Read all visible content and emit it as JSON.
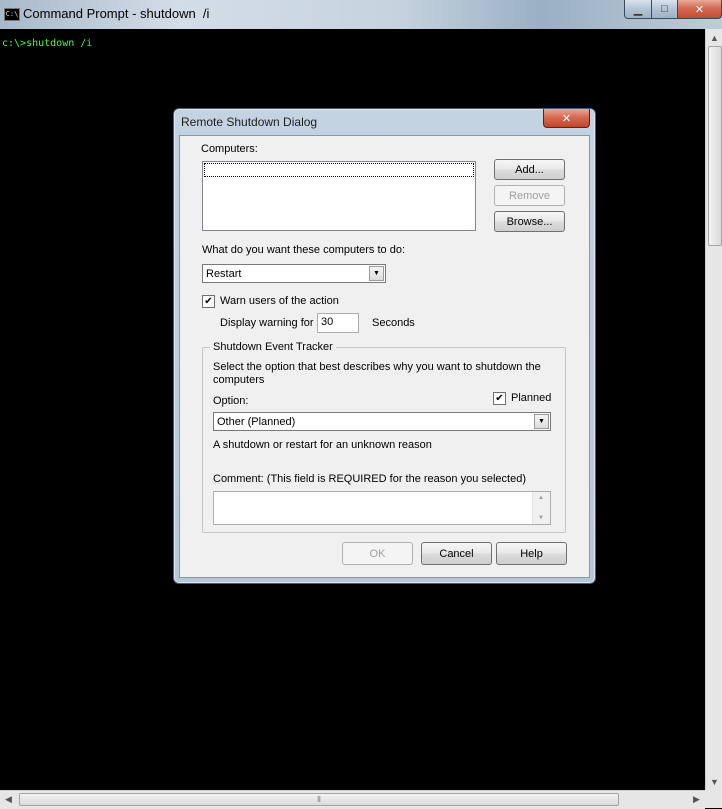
{
  "console": {
    "title": "Command Prompt - shutdown  /i",
    "icon_text": "C:\\",
    "command_line": "c:\\>shutdown /i",
    "minimize_glyph": "▁",
    "maximize_glyph": "□",
    "close_glyph": "✕",
    "text_color": "#3cff3c"
  },
  "dialog": {
    "title": "Remote Shutdown Dialog",
    "close_glyph": "✕",
    "computers_label": "Computers:",
    "buttons": {
      "add": "Add...",
      "remove": "Remove",
      "browse": "Browse..."
    },
    "action_label": "What do you want these computers to do:",
    "action_selected": "Restart",
    "warn_checkbox": {
      "label": "Warn users of the action",
      "checked": true,
      "mark": "✔"
    },
    "display_warning_label": "Display warning for",
    "warning_seconds": "30",
    "seconds_label": "Seconds",
    "tracker": {
      "legend": "Shutdown Event Tracker",
      "description": "Select the option that best describes why you want to shutdown the computers",
      "option_label": "Option:",
      "planned": {
        "label": "Planned",
        "checked": true,
        "mark": "✔"
      },
      "option_selected": "Other (Planned)",
      "reason_text": "A shutdown or restart for an unknown reason",
      "comment_label": "Comment: (This field is REQUIRED for the reason you selected)",
      "comment_value": ""
    },
    "footer": {
      "ok": "OK",
      "cancel": "Cancel",
      "help": "Help"
    }
  }
}
